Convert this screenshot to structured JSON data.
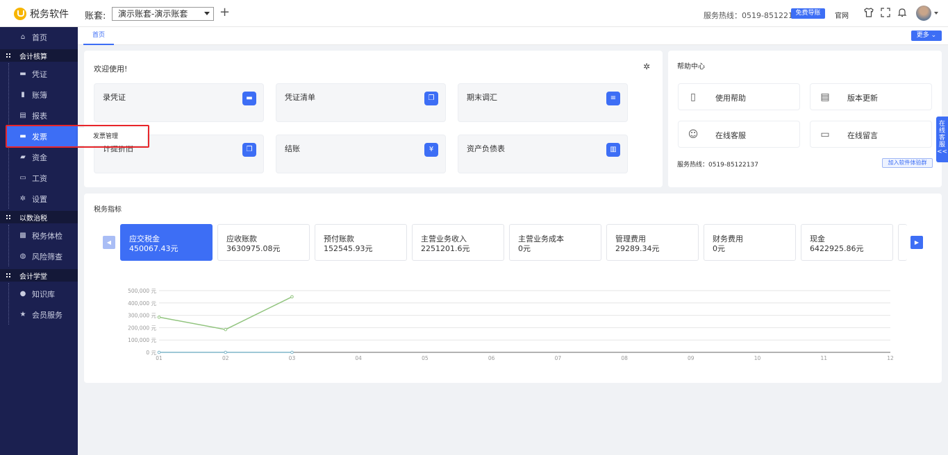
{
  "topbar": {
    "app_name": "税务软件",
    "account_label": "账套:",
    "account_value": "演示账套-演示账套",
    "hotline": "服务热线：0519-85122137",
    "free_guide": "免费导账",
    "homepage": "官网"
  },
  "sidebar": {
    "home": "首页",
    "groups": [
      {
        "label": "会计核算",
        "items": [
          "凭证",
          "账簿",
          "报表",
          "发票",
          "资金",
          "工资",
          "设置"
        ]
      },
      {
        "label": "以数治税",
        "items": [
          "税务体检",
          "风险筛查"
        ]
      },
      {
        "label": "会计学堂",
        "items": [
          "知识库",
          "会员服务"
        ]
      }
    ],
    "active_item": "发票",
    "flyout_label": "发票管理"
  },
  "tabs": {
    "current": "首页",
    "more": "更多"
  },
  "welcome": {
    "title": "欢迎使用!",
    "quick": [
      {
        "label": "录凭证",
        "icon": "ticket-icon"
      },
      {
        "label": "凭证清单",
        "icon": "copy-icon"
      },
      {
        "label": "期末调汇",
        "icon": "database-icon"
      },
      {
        "label": "计提折旧",
        "icon": "files-icon"
      },
      {
        "label": "结账",
        "icon": "yen-icon"
      },
      {
        "label": "资产负债表",
        "icon": "chart-icon"
      }
    ]
  },
  "help": {
    "title": "帮助中心",
    "cards": [
      {
        "label": "使用帮助",
        "icon": "book-icon"
      },
      {
        "label": "版本更新",
        "icon": "doc-gear-icon"
      },
      {
        "label": "在线客服",
        "icon": "support-icon"
      },
      {
        "label": "在线留言",
        "icon": "message-icon"
      }
    ],
    "hotline": "服务热线：0519-85122137",
    "join_group": "加入软件体验群"
  },
  "float_service": [
    "在",
    "线",
    "客",
    "服",
    "<<"
  ],
  "tax": {
    "title": "税务指标",
    "indicators": [
      {
        "name": "应交税金",
        "value": "450067.43元"
      },
      {
        "name": "应收账款",
        "value": "3630975.08元"
      },
      {
        "name": "预付账款",
        "value": "152545.93元"
      },
      {
        "name": "主营业务收入",
        "value": "2251201.6元"
      },
      {
        "name": "主营业务成本",
        "value": "0元"
      },
      {
        "name": "管理费用",
        "value": "29289.34元"
      },
      {
        "name": "财务费用",
        "value": "0元"
      },
      {
        "name": "现金",
        "value": "6422925.86元"
      }
    ]
  },
  "chart_data": {
    "type": "line",
    "categories": [
      "01",
      "02",
      "03",
      "04",
      "05",
      "06",
      "07",
      "08",
      "09",
      "10",
      "11",
      "12"
    ],
    "y_ticks": [
      "0 元",
      "100,000 元",
      "200,000 元",
      "300,000 元",
      "400,000 元",
      "500,000 元"
    ],
    "ylim": [
      0,
      500000
    ],
    "grid": true,
    "series": [
      {
        "values": [
          285000,
          185000,
          450000
        ],
        "color": "#91c47e"
      },
      {
        "values": [
          0,
          0,
          0
        ],
        "color": "#7fb6c9"
      }
    ]
  }
}
